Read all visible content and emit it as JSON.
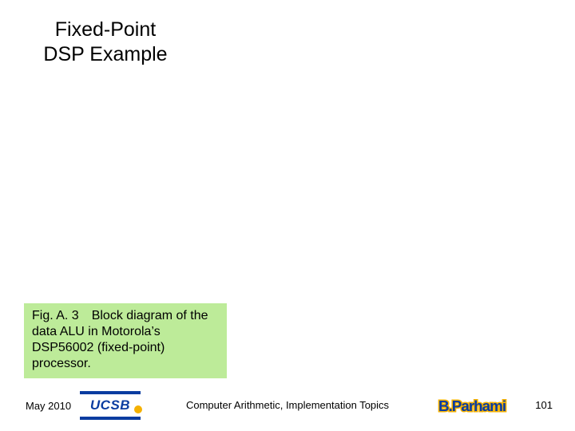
{
  "title_line1": "Fixed-Point",
  "title_line2": "DSP Example",
  "caption": "Fig. A. 3 Block diagram of the data ALU in Motorola’s DSP56002 (fixed-point) processor.",
  "footer": {
    "date": "May 2010",
    "logo_text": "UCSB",
    "center": "Computer Arithmetic, Implementation Topics",
    "author": "B.Parhami",
    "page": "101"
  }
}
